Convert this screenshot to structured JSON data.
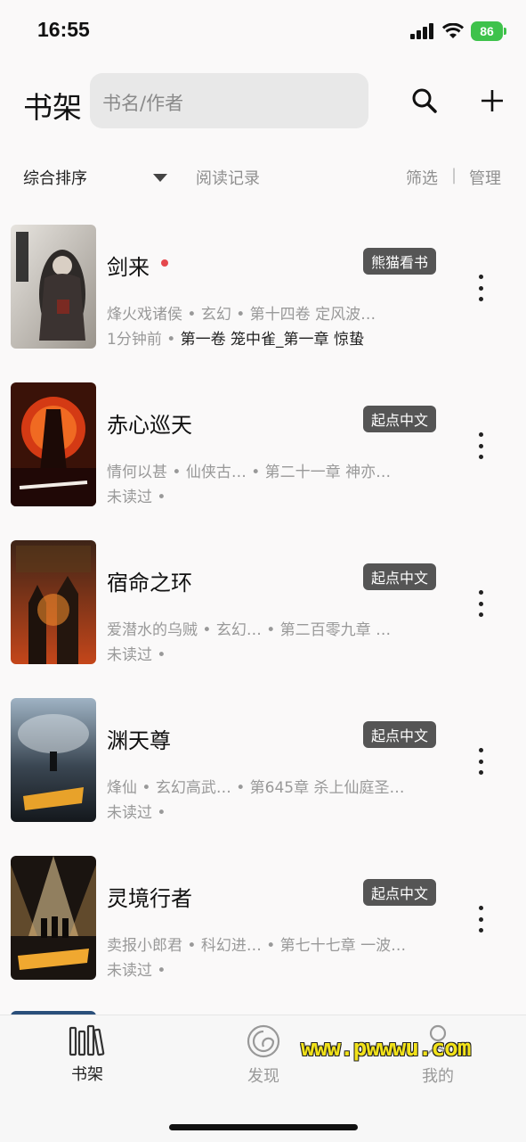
{
  "status": {
    "time": "16:55",
    "battery": "86"
  },
  "header": {
    "title": "书架",
    "search_placeholder": "书名/作者"
  },
  "toolbar": {
    "sort": "综合排序",
    "history": "阅读记录",
    "filter": "筛选",
    "divider": "|",
    "manage": "管理"
  },
  "books": [
    {
      "title": "剑来",
      "source": "熊猫看书",
      "meta": "烽火戏诸侯 • 玄幻 • 第十四卷 定风波…",
      "progress_prefix": "1分钟前 • ",
      "progress_chapter": "第一卷 笼中雀_第一章 惊蛰",
      "updated": true
    },
    {
      "title": "赤心巡天",
      "source": "起点中文",
      "meta": "情何以甚 • 仙侠古…  • 第二十一章 神亦…",
      "progress_prefix": "未读过 •",
      "progress_chapter": "",
      "updated": false
    },
    {
      "title": "宿命之环",
      "source": "起点中文",
      "meta": "爱潜水的乌贼 • 玄幻…  • 第二百零九章 …",
      "progress_prefix": "未读过 •",
      "progress_chapter": "",
      "updated": false
    },
    {
      "title": "渊天尊",
      "source": "起点中文",
      "meta": "烽仙 • 玄幻高武… • 第645章 杀上仙庭圣…",
      "progress_prefix": "未读过 •",
      "progress_chapter": "",
      "updated": false
    },
    {
      "title": "灵境行者",
      "source": "起点中文",
      "meta": "卖报小郎君 • 科幻进… • 第七十七章 一波…",
      "progress_prefix": "未读过 •",
      "progress_chapter": "",
      "updated": false
    }
  ],
  "tabs": [
    {
      "label": "书架",
      "active": true
    },
    {
      "label": "发现",
      "active": false
    },
    {
      "label": "我的",
      "active": false
    }
  ],
  "watermark": "www.pwwwu.com",
  "colors": {
    "badge_bg": "#555555",
    "update_dot": "#e5484d",
    "battery": "#3ec24b"
  }
}
